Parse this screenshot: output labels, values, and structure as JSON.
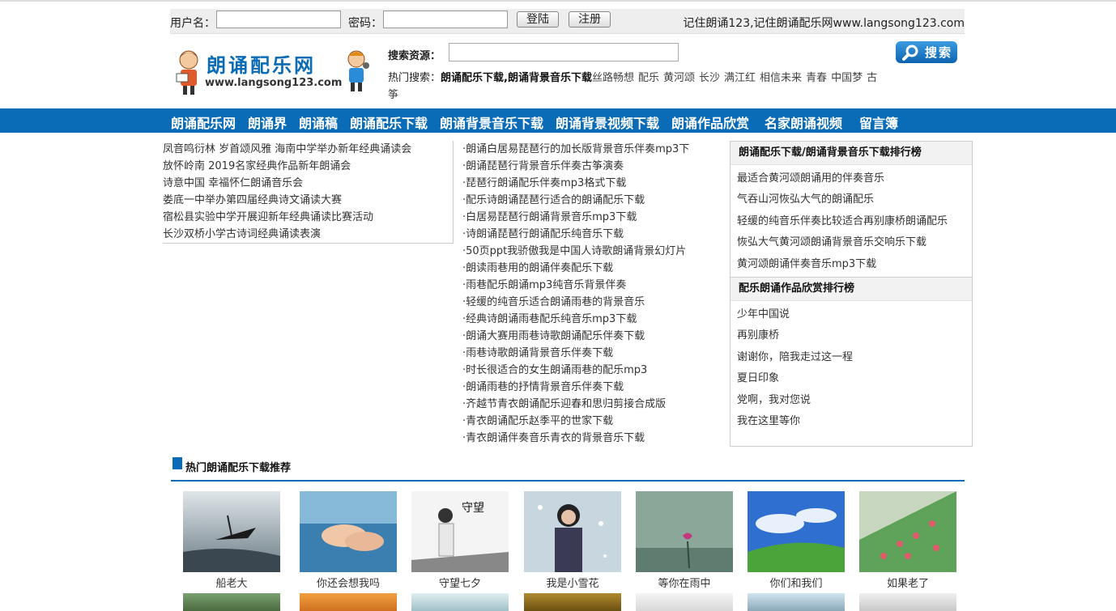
{
  "login": {
    "username_label": "用户名：",
    "password_label": "密码：",
    "username_value": "",
    "password_value": "",
    "login_button": "登陆",
    "register_button": "注册",
    "slogan": "记住朗诵123,记住朗诵配乐网www.langsong123.com"
  },
  "logo": {
    "title": "朗诵配乐网",
    "url": "www.langsong123.com"
  },
  "search": {
    "label": "搜索资源：",
    "value": "",
    "button": "搜索",
    "hot_label": "热门搜索：",
    "hot_bold": "朗诵配乐下载,朗诵背景音乐下载",
    "hot_terms": [
      "丝路畅想",
      "配乐",
      "黄河颂",
      "长沙",
      "满江红",
      "相信未来",
      "青春",
      "中国梦",
      "古筝"
    ]
  },
  "nav": [
    "朗诵配乐网",
    "朗诵界",
    "朗诵稿",
    "朗诵配乐下载",
    "朗诵背景音乐下载",
    "朗诵背景视频下载",
    "朗诵作品欣赏",
    "名家朗诵视频",
    "留言簿"
  ],
  "news_left": [
    "凤音鸣衍林 岁首颂风雅 海南中学举办新年经典诵读会",
    "放怀岭南 2019名家经典作品新年朗诵会",
    "诗意中国 幸福怀仁朗诵音乐会",
    "娄底一中举办第四届经典诗文诵读大赛",
    "宿松县实验中学开展迎新年经典诵读比赛活动",
    "长沙双桥小学古诗词经典诵读表演"
  ],
  "news_mid": [
    "·朗诵白居易琵琶行的加长版背景音乐伴奏mp3下",
    "·朗诵琵琶行背景音乐伴奏古筝演奏",
    "·琵琶行朗诵配乐伴奏mp3格式下载",
    "·配乐诗朗诵琵琶行适合的朗诵配乐下载",
    "·白居易琵琶行朗诵背景音乐mp3下载",
    "·诗朗诵琵琶行朗诵配乐纯音乐下载",
    "·50页ppt我骄傲我是中国人诗歌朗诵背景幻灯片",
    "·朗读雨巷用的朗诵伴奏配乐下载",
    "·雨巷配乐朗诵mp3纯音乐背景伴奏",
    "·轻缓的纯音乐适合朗诵雨巷的背景音乐",
    "·经典诗朗诵雨巷配乐纯音乐mp3下载",
    "·朗诵大赛用雨巷诗歌朗诵配乐伴奏下载",
    "·雨巷诗歌朗诵背景音乐伴奏下载",
    "·时长很适合的女生朗诵雨巷的配乐mp3",
    "·朗诵雨巷的抒情背景音乐伴奏下载",
    "·齐越节青衣朗诵配乐迎春和思归剪接合成版",
    "·青衣朗诵配乐赵季平的世家下载",
    "·青衣朗诵伴奏音乐青衣的背景音乐下载"
  ],
  "rank1": {
    "title": "朗诵配乐下载/朗诵背景音乐下载排行榜",
    "items": [
      "最适合黄河颂朗诵用的伴奏音乐",
      "气吞山河恢弘大气的朗诵配乐",
      "轻缓的纯音乐伴奏比较适合再别康桥朗诵配乐",
      "恢弘大气黄河颂朗诵背景音乐交响乐下载",
      "黄河颂朗诵伴奏音乐mp3下载"
    ]
  },
  "rank2": {
    "title": "配乐朗诵作品欣赏排行榜",
    "items": [
      "少年中国说",
      "再别康桥",
      "谢谢你，陪我走过这一程",
      "夏日印象",
      "党啊，我对您说",
      "我在这里等你"
    ]
  },
  "section": {
    "title": "热门朗诵配乐下载推荐"
  },
  "thumbs": [
    {
      "caption": "船老大"
    },
    {
      "caption": "你还会想我吗"
    },
    {
      "caption": "守望七夕",
      "overlay": "守望"
    },
    {
      "caption": "我是小雪花"
    },
    {
      "caption": "等你在雨中"
    },
    {
      "caption": "你们和我们"
    },
    {
      "caption": "如果老了"
    }
  ]
}
